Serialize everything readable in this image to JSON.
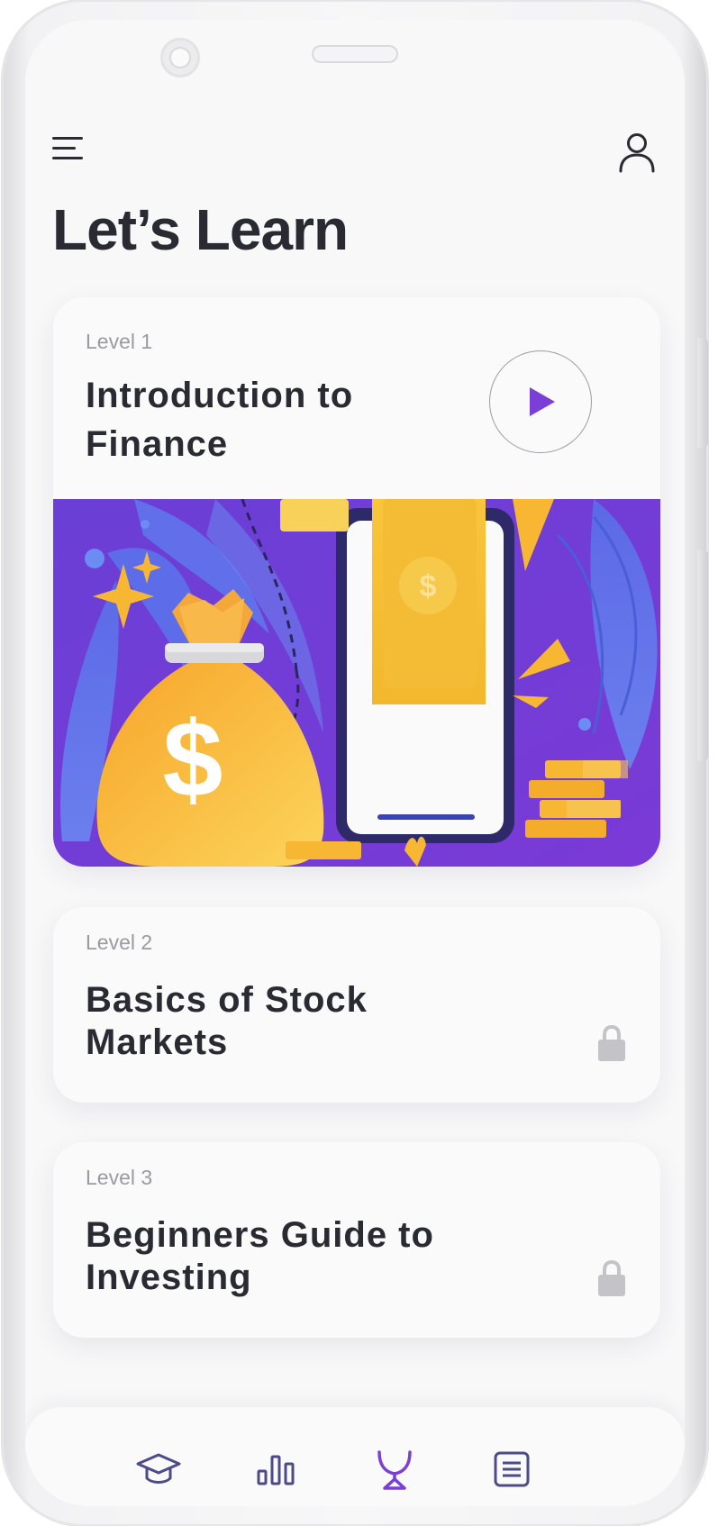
{
  "app": {
    "title": "Let’s Learn"
  },
  "header": {
    "menu_icon": "hamburger-menu-icon",
    "profile_icon": "user-profile-icon"
  },
  "courses": [
    {
      "level": "Level 1",
      "title": "Introduction to Finance",
      "state": "unlocked",
      "action_icon": "play-icon"
    },
    {
      "level": "Level 2",
      "title": "Basics of Stock Markets",
      "state": "locked",
      "action_icon": "lock-icon"
    },
    {
      "level": "Level 3",
      "title": "Beginners Guide to Investing",
      "state": "locked",
      "action_icon": "lock-icon"
    }
  ],
  "tabs": [
    {
      "icon": "graduation-cap-icon",
      "active": false
    },
    {
      "icon": "bar-chart-icon",
      "active": false
    },
    {
      "icon": "trophy-icon",
      "active": true
    },
    {
      "icon": "list-document-icon",
      "active": false
    }
  ],
  "colors": {
    "accent": "#7b3fd8",
    "illustration_bg": "#7b3fd8",
    "gold": "#f7b733",
    "text": "#2a2a33",
    "muted": "#9a9aa1",
    "lock": "#c4c4c8",
    "tab_icon": "#4b4b8a"
  }
}
